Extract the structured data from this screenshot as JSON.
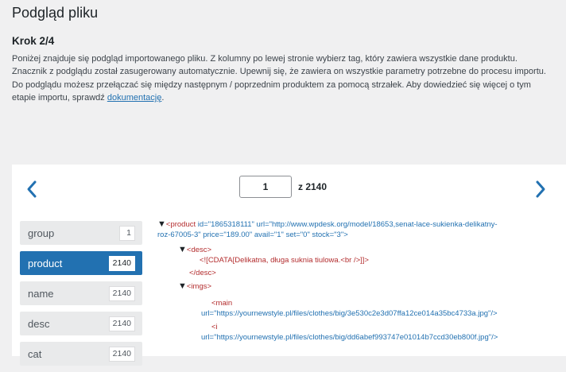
{
  "header": {
    "title": "Podgląd pliku",
    "step": "Krok 2/4",
    "description_line1": "Poniżej znajduje się podgląd importowanego pliku. Z kolumny po lewej stronie wybierz tag, który zawiera wszystkie dane produktu.",
    "description_line2": "Znacznik z podglądu został zasugerowany automatycznie. Upewnij się, że zawiera on wszystkie parametry potrzebne do procesu importu.",
    "description_line3": "Do podglądu możesz przełączać się między następnym / poprzednim produktem za pomocą strzałek. Aby dowiedzieć się więcej o tym",
    "description_line4_prefix": "etapie importu, sprawdź ",
    "doc_link": "dokumentację",
    "description_line4_suffix": "."
  },
  "pager": {
    "current": "1",
    "of_label": "z 2140"
  },
  "tags": [
    {
      "name": "group",
      "count": "1",
      "active": false
    },
    {
      "name": "product",
      "count": "2140",
      "active": true
    },
    {
      "name": "name",
      "count": "2140",
      "active": false
    },
    {
      "name": "desc",
      "count": "2140",
      "active": false
    },
    {
      "name": "cat",
      "count": "2140",
      "active": false
    }
  ],
  "xml": {
    "product_open": "<product",
    "product_attrs_1": " id=\"1865318111\" url=\"http://www.wpdesk.org/model/18653,senat-lace-sukienka-delikatny-",
    "product_attrs_2": "roz-67005-3\" price=\"189.00\" avail=\"1\" set=\"0\" stock=\"3\">",
    "desc_open": "<desc>",
    "cdata": "<![CDATA[Delikatna, długa suknia tiulowa.<br />]]>",
    "desc_close": "</desc>",
    "imgs_open": "<imgs>",
    "main_tag": "<main",
    "main_url": "url=\"https://yournewstyle.pl/files/clothes/big/3e530c2e3d07ffa12ce014a35bc4733a.jpg\"/>",
    "i_tag": "<i",
    "i_url": "url=\"https://yournewstyle.pl/files/clothes/big/dd6abef993747e01014b7ccd30eb800f.jpg\"/>"
  },
  "colors": {
    "accent": "#2271b1",
    "xml_tag": "#b32d2e",
    "background": "#f0f0f1"
  }
}
